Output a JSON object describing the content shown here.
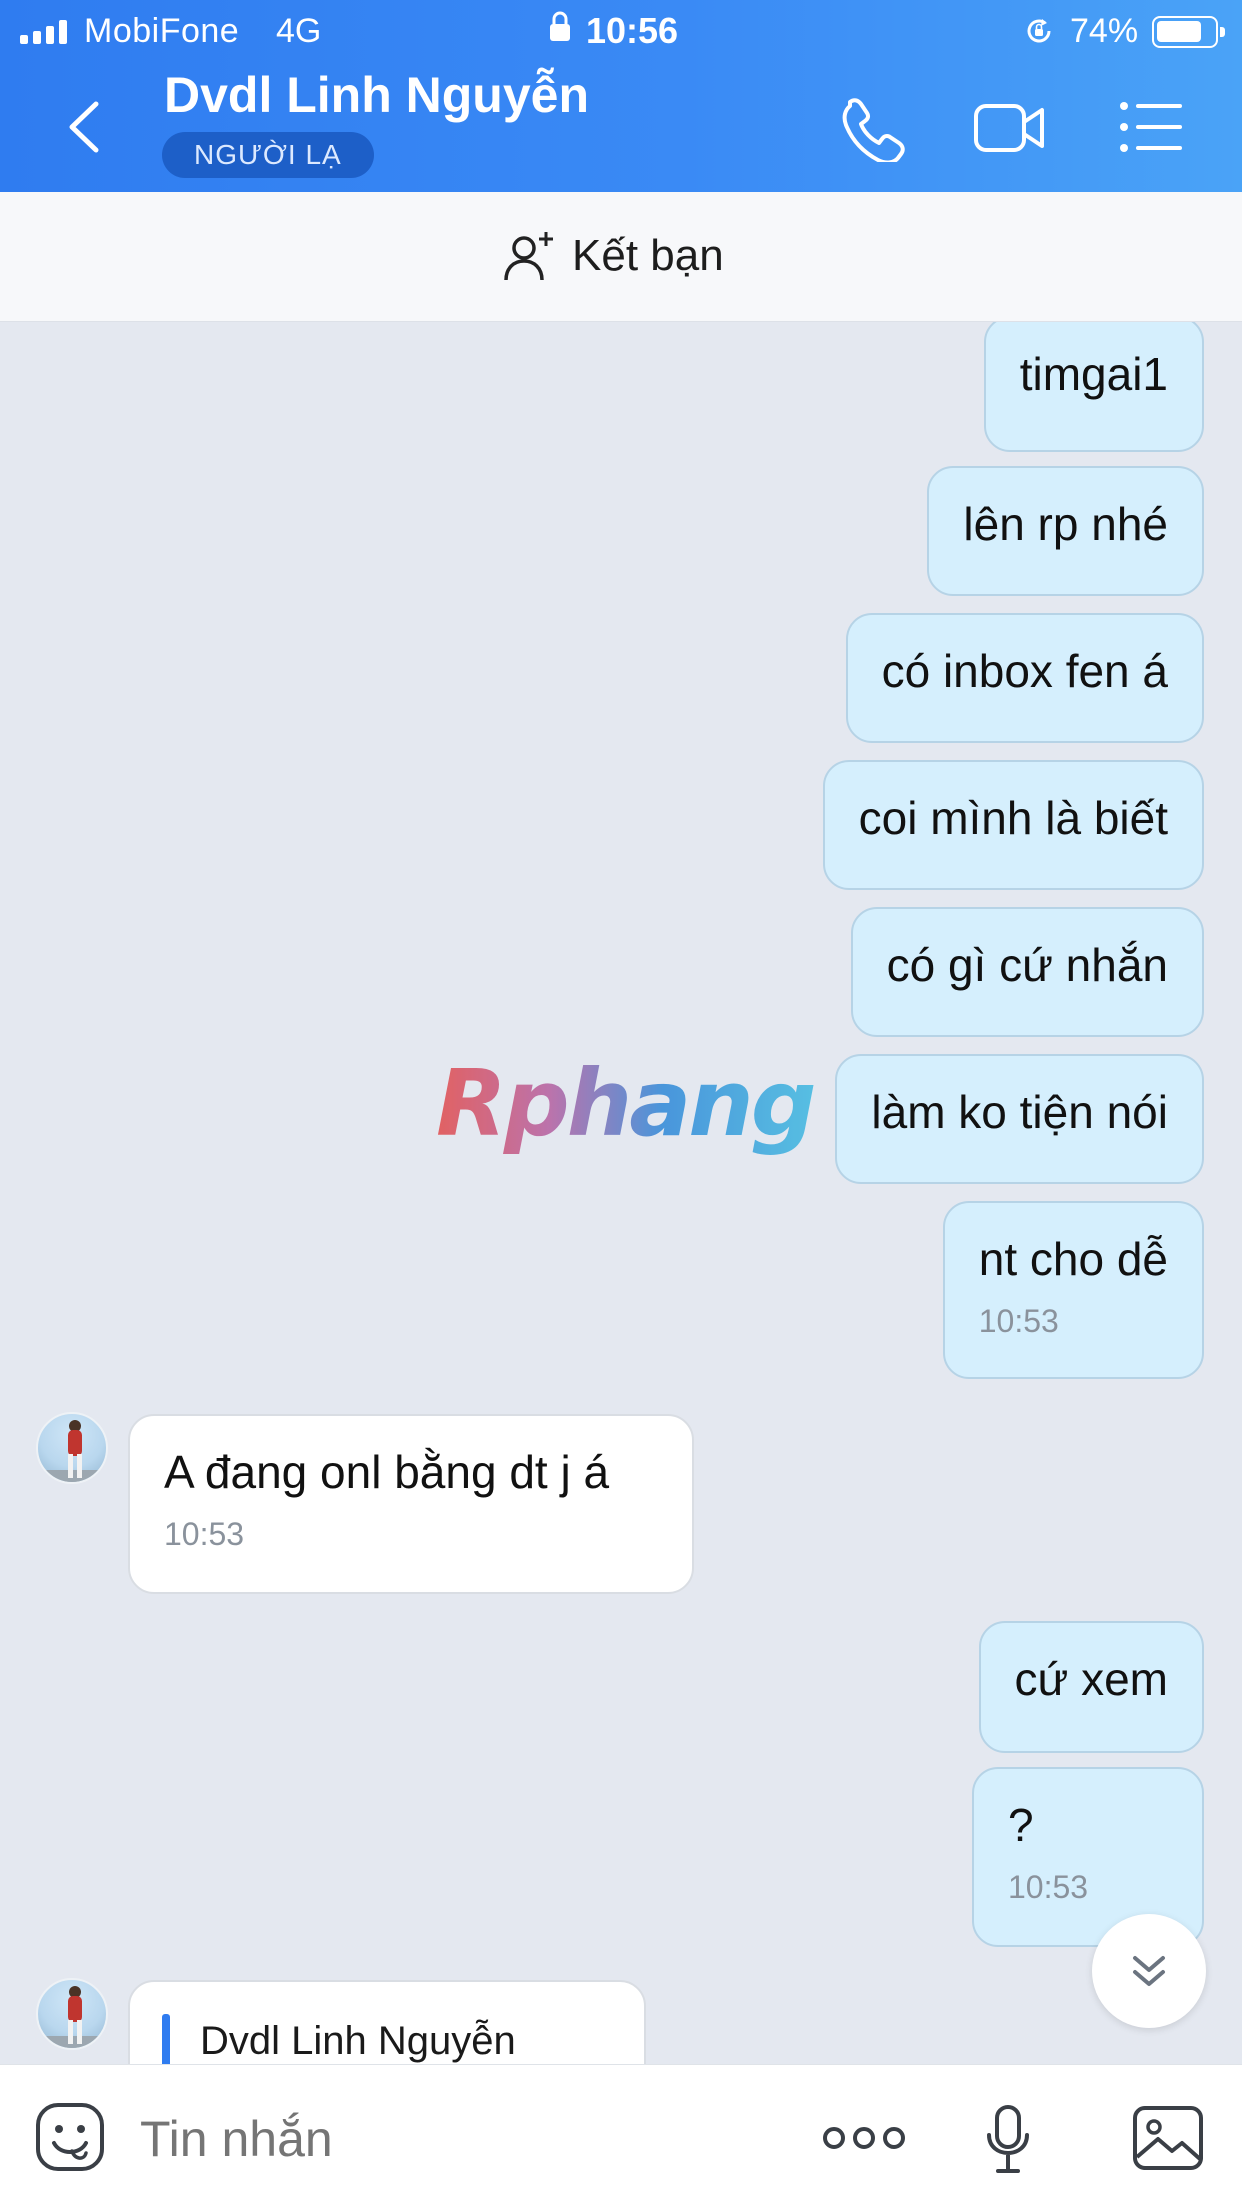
{
  "status_bar": {
    "carrier": "MobiFone",
    "network": "4G",
    "time": "10:56",
    "battery": "74%",
    "battery_level": 0.74
  },
  "header": {
    "contact_name": "Dvdl Linh Nguyễn",
    "badge": "NGƯỜI LẠ",
    "icons": [
      "back-icon",
      "phone-icon",
      "video-call-icon",
      "menu-icon"
    ]
  },
  "friend_bar": {
    "label": "Kết bạn",
    "icon": "add-user-icon"
  },
  "messages": [
    {
      "from": "me",
      "text": "timgai1"
    },
    {
      "from": "me",
      "text": "lên rp nhé"
    },
    {
      "from": "me",
      "text": "có inbox fen á"
    },
    {
      "from": "me",
      "text": "coi mình là biết"
    },
    {
      "from": "me",
      "text": "có gì cứ nhắn"
    },
    {
      "from": "me",
      "text": "làm ko tiện nói"
    },
    {
      "from": "me",
      "text": "nt cho dễ",
      "time": "10:53"
    },
    {
      "from": "them",
      "text": "A đang onl bằng dt j á",
      "time": "10:53"
    },
    {
      "from": "me",
      "text": "cứ xem"
    },
    {
      "from": "me",
      "text": "?",
      "time": "10:53"
    },
    {
      "from": "them",
      "reply_name": "Dvdl Linh Nguyễn"
    }
  ],
  "watermark": "Rphang",
  "composer": {
    "placeholder": "Tin nhắn",
    "icons": [
      "emoji-icon",
      "more-icon",
      "microphone-icon",
      "image-icon"
    ]
  },
  "colors": {
    "header_start": "#2f7cf0",
    "header_end": "#4aa3f7",
    "my_bubble": "#d5effd",
    "their_bubble": "#ffffff",
    "chat_bg": "#e4e8f0",
    "badge_bg": "#1d5fc8"
  }
}
